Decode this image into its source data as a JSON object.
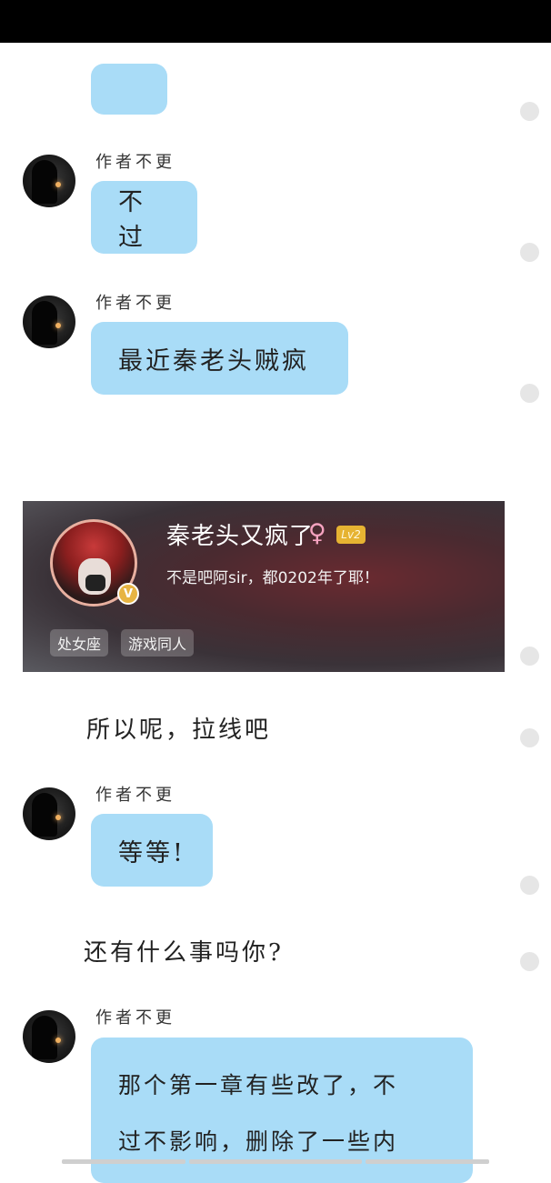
{
  "author_name": "作者不更",
  "messages": [
    {
      "text": "不过"
    },
    {
      "text": "最近秦老头贼疯"
    },
    {
      "text": "等等!"
    },
    {
      "lines": [
        "那个第一章有些改了，不",
        "过不影响，删除了一些内"
      ]
    }
  ],
  "narration": [
    "所以呢，拉线吧",
    "还有什么事吗你?"
  ],
  "profile_card": {
    "nickname": "秦老头又疯了",
    "gender_symbol": "♀",
    "level": "Lv2",
    "bio": "不是吧阿sir，都0202年了耶！",
    "verified_badge": "V",
    "tags": [
      "处女座",
      "游戏同人"
    ]
  },
  "colors": {
    "bubble": "#a9dcf7",
    "status_bar": "#000000",
    "level_badge": "#e6b332"
  },
  "icons": [
    "avatar-image",
    "gender-female-icon",
    "verified-badge-icon",
    "timeline-dot"
  ]
}
